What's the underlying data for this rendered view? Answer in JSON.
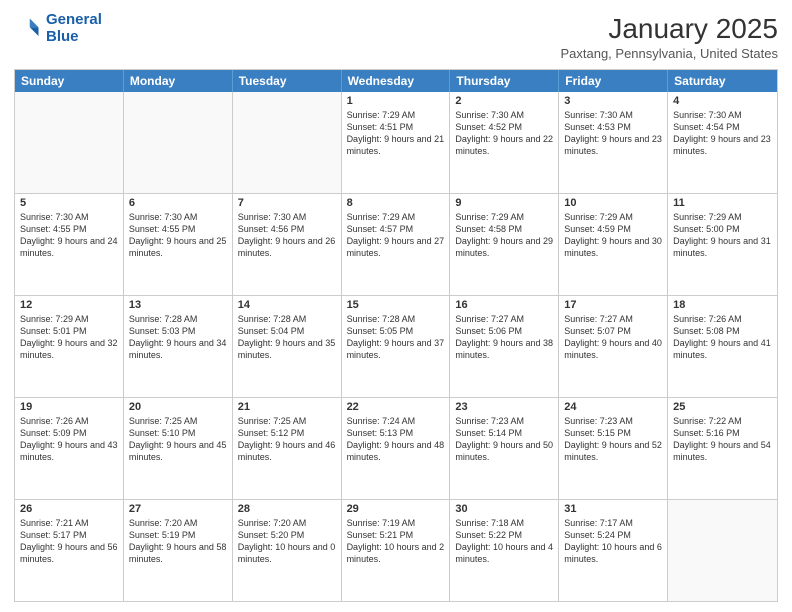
{
  "logo": {
    "line1": "General",
    "line2": "Blue"
  },
  "title": "January 2025",
  "subtitle": "Paxtang, Pennsylvania, United States",
  "headers": [
    "Sunday",
    "Monday",
    "Tuesday",
    "Wednesday",
    "Thursday",
    "Friday",
    "Saturday"
  ],
  "weeks": [
    [
      {
        "day": "",
        "text": "",
        "empty": true
      },
      {
        "day": "",
        "text": "",
        "empty": true
      },
      {
        "day": "",
        "text": "",
        "empty": true
      },
      {
        "day": "1",
        "text": "Sunrise: 7:29 AM\nSunset: 4:51 PM\nDaylight: 9 hours and 21 minutes."
      },
      {
        "day": "2",
        "text": "Sunrise: 7:30 AM\nSunset: 4:52 PM\nDaylight: 9 hours and 22 minutes."
      },
      {
        "day": "3",
        "text": "Sunrise: 7:30 AM\nSunset: 4:53 PM\nDaylight: 9 hours and 23 minutes."
      },
      {
        "day": "4",
        "text": "Sunrise: 7:30 AM\nSunset: 4:54 PM\nDaylight: 9 hours and 23 minutes."
      }
    ],
    [
      {
        "day": "5",
        "text": "Sunrise: 7:30 AM\nSunset: 4:55 PM\nDaylight: 9 hours and 24 minutes."
      },
      {
        "day": "6",
        "text": "Sunrise: 7:30 AM\nSunset: 4:55 PM\nDaylight: 9 hours and 25 minutes."
      },
      {
        "day": "7",
        "text": "Sunrise: 7:30 AM\nSunset: 4:56 PM\nDaylight: 9 hours and 26 minutes."
      },
      {
        "day": "8",
        "text": "Sunrise: 7:29 AM\nSunset: 4:57 PM\nDaylight: 9 hours and 27 minutes."
      },
      {
        "day": "9",
        "text": "Sunrise: 7:29 AM\nSunset: 4:58 PM\nDaylight: 9 hours and 29 minutes."
      },
      {
        "day": "10",
        "text": "Sunrise: 7:29 AM\nSunset: 4:59 PM\nDaylight: 9 hours and 30 minutes."
      },
      {
        "day": "11",
        "text": "Sunrise: 7:29 AM\nSunset: 5:00 PM\nDaylight: 9 hours and 31 minutes."
      }
    ],
    [
      {
        "day": "12",
        "text": "Sunrise: 7:29 AM\nSunset: 5:01 PM\nDaylight: 9 hours and 32 minutes."
      },
      {
        "day": "13",
        "text": "Sunrise: 7:28 AM\nSunset: 5:03 PM\nDaylight: 9 hours and 34 minutes."
      },
      {
        "day": "14",
        "text": "Sunrise: 7:28 AM\nSunset: 5:04 PM\nDaylight: 9 hours and 35 minutes."
      },
      {
        "day": "15",
        "text": "Sunrise: 7:28 AM\nSunset: 5:05 PM\nDaylight: 9 hours and 37 minutes."
      },
      {
        "day": "16",
        "text": "Sunrise: 7:27 AM\nSunset: 5:06 PM\nDaylight: 9 hours and 38 minutes."
      },
      {
        "day": "17",
        "text": "Sunrise: 7:27 AM\nSunset: 5:07 PM\nDaylight: 9 hours and 40 minutes."
      },
      {
        "day": "18",
        "text": "Sunrise: 7:26 AM\nSunset: 5:08 PM\nDaylight: 9 hours and 41 minutes."
      }
    ],
    [
      {
        "day": "19",
        "text": "Sunrise: 7:26 AM\nSunset: 5:09 PM\nDaylight: 9 hours and 43 minutes."
      },
      {
        "day": "20",
        "text": "Sunrise: 7:25 AM\nSunset: 5:10 PM\nDaylight: 9 hours and 45 minutes."
      },
      {
        "day": "21",
        "text": "Sunrise: 7:25 AM\nSunset: 5:12 PM\nDaylight: 9 hours and 46 minutes."
      },
      {
        "day": "22",
        "text": "Sunrise: 7:24 AM\nSunset: 5:13 PM\nDaylight: 9 hours and 48 minutes."
      },
      {
        "day": "23",
        "text": "Sunrise: 7:23 AM\nSunset: 5:14 PM\nDaylight: 9 hours and 50 minutes."
      },
      {
        "day": "24",
        "text": "Sunrise: 7:23 AM\nSunset: 5:15 PM\nDaylight: 9 hours and 52 minutes."
      },
      {
        "day": "25",
        "text": "Sunrise: 7:22 AM\nSunset: 5:16 PM\nDaylight: 9 hours and 54 minutes."
      }
    ],
    [
      {
        "day": "26",
        "text": "Sunrise: 7:21 AM\nSunset: 5:17 PM\nDaylight: 9 hours and 56 minutes."
      },
      {
        "day": "27",
        "text": "Sunrise: 7:20 AM\nSunset: 5:19 PM\nDaylight: 9 hours and 58 minutes."
      },
      {
        "day": "28",
        "text": "Sunrise: 7:20 AM\nSunset: 5:20 PM\nDaylight: 10 hours and 0 minutes."
      },
      {
        "day": "29",
        "text": "Sunrise: 7:19 AM\nSunset: 5:21 PM\nDaylight: 10 hours and 2 minutes."
      },
      {
        "day": "30",
        "text": "Sunrise: 7:18 AM\nSunset: 5:22 PM\nDaylight: 10 hours and 4 minutes."
      },
      {
        "day": "31",
        "text": "Sunrise: 7:17 AM\nSunset: 5:24 PM\nDaylight: 10 hours and 6 minutes."
      },
      {
        "day": "",
        "text": "",
        "empty": true
      }
    ]
  ]
}
